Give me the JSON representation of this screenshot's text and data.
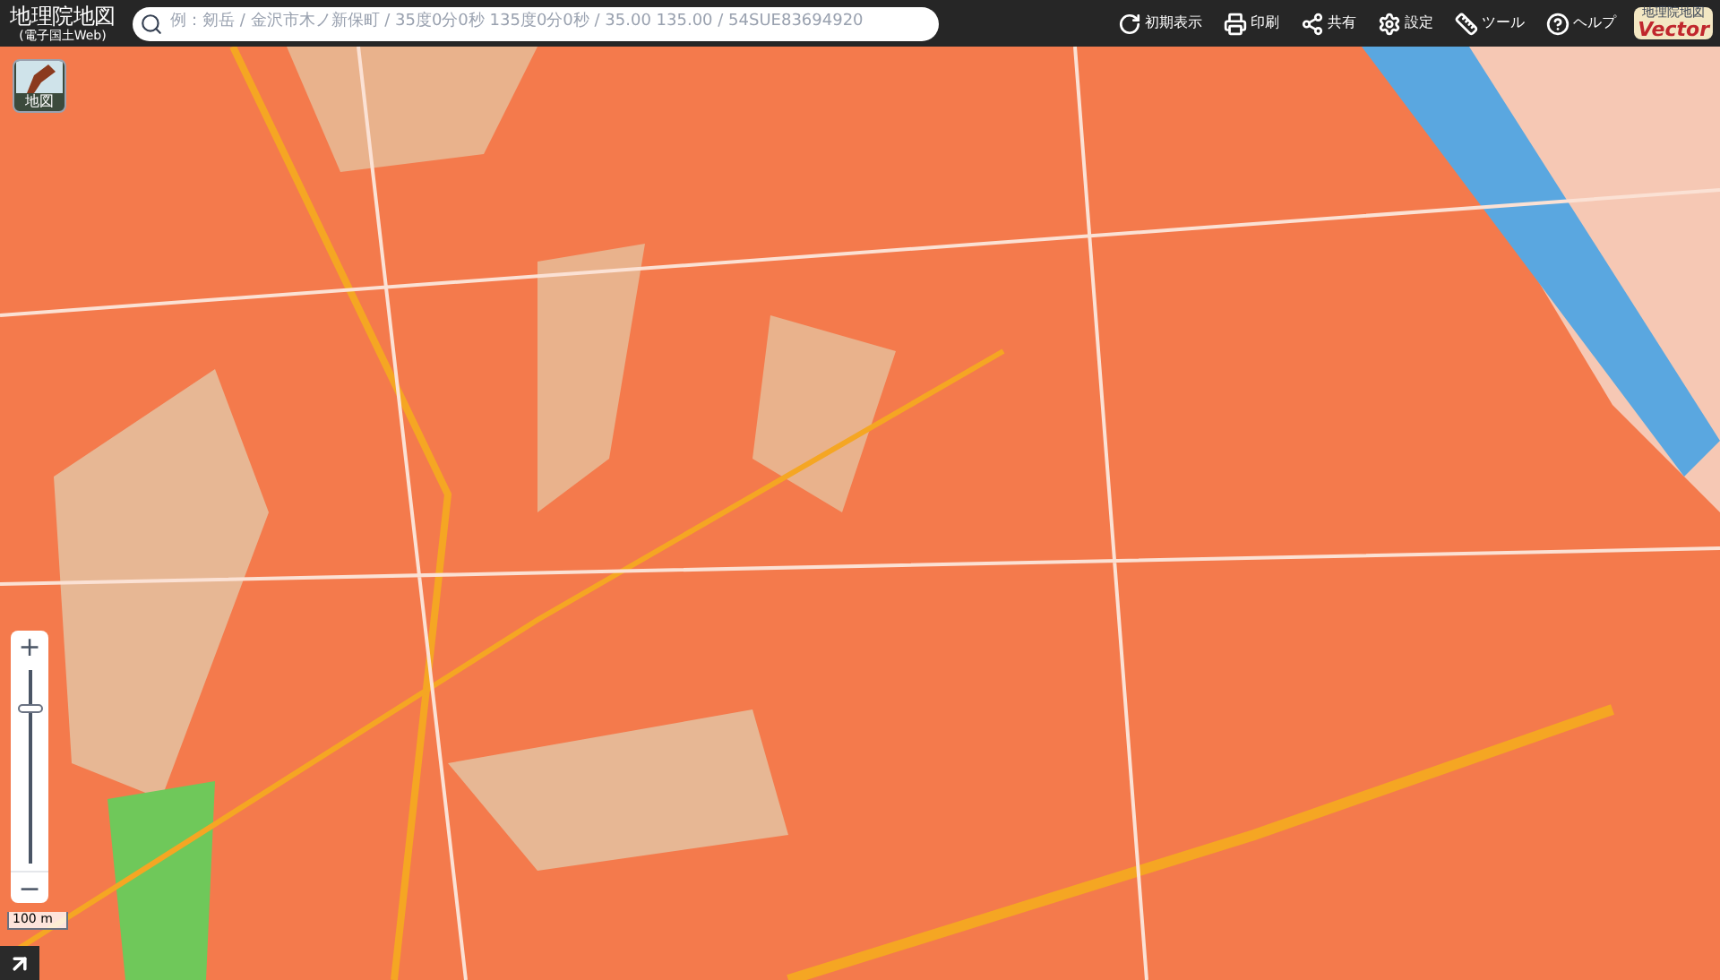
{
  "header": {
    "title": "地理院地図",
    "subtitle": "(電子国土Web)",
    "search": {
      "placeholder": "例：剱岳 / 金沢市木ノ新保町 / 35度0分0秒 135度0分0秒 / 35.00 135.00 / 54SUE83694920"
    },
    "tools": [
      {
        "kind": "reset",
        "label": "初期表示"
      },
      {
        "kind": "print",
        "label": "印刷"
      },
      {
        "kind": "share",
        "label": "共有"
      },
      {
        "kind": "settings",
        "label": "設定"
      },
      {
        "kind": "tools",
        "label": "ツール"
      },
      {
        "kind": "help",
        "label": "ヘルプ"
      }
    ],
    "badge": {
      "top": "地理院地図",
      "bottom": "Vector"
    }
  },
  "map": {
    "layer_button": {
      "label": "地図"
    },
    "zoom": {
      "plus": "+",
      "minus": "−",
      "level": 0.82
    },
    "scale": "100 m"
  }
}
